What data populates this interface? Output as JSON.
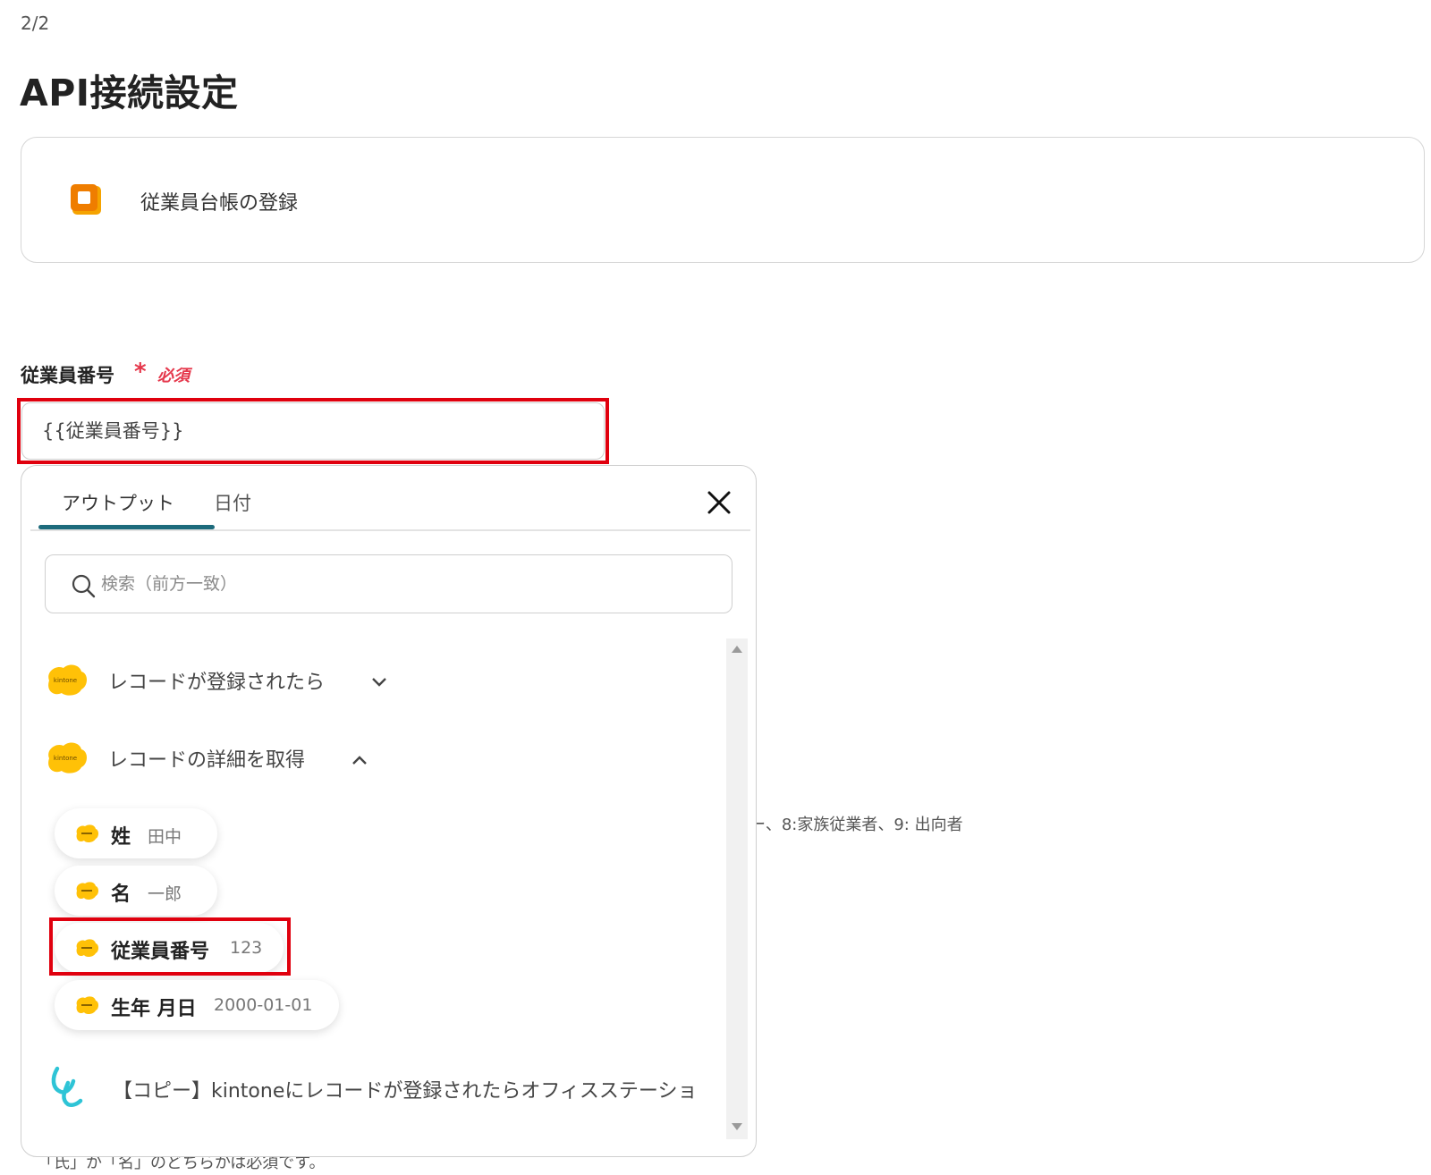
{
  "header": {
    "step": "2/2",
    "title": "API接続設定"
  },
  "action": {
    "name": "従業員台帳の登録",
    "icon": "office-station-icon",
    "icon_color": "#f08a00"
  },
  "field": {
    "label": "従業員番号",
    "required_mark": "*",
    "required_text": "必須",
    "value": "{{従業員番号}}"
  },
  "background_text": {
    "options_fragment": "ー、8:家族従業者、9: 出向者",
    "hint": "「氏」か「名」のどちらかは必須です。"
  },
  "popup": {
    "tabs": [
      {
        "label": "アウトプット",
        "active": true
      },
      {
        "label": "日付",
        "active": false
      }
    ],
    "search_placeholder": "検索（前方一致）",
    "groups": [
      {
        "label": "レコードが登録されたら",
        "expanded": false
      },
      {
        "label": "レコードの詳細を取得",
        "expanded": true
      }
    ],
    "items": [
      {
        "label": "姓",
        "value": "田中"
      },
      {
        "label": "名",
        "value": "一郎"
      },
      {
        "label": "従業員番号",
        "value": "123",
        "highlighted": true
      },
      {
        "label": "生年 月日",
        "value": "2000-01-01"
      }
    ],
    "copy_item": "【コピー】kintoneにレコードが登録されたらオフィスステーショ"
  },
  "colors": {
    "accent": "#1d6b7c",
    "required": "#e5374b",
    "highlight": "#e0000e",
    "kintone": "#ffc107"
  }
}
